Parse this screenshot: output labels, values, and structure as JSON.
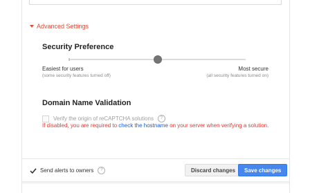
{
  "advanced": {
    "label": "Advanced Settings"
  },
  "security": {
    "title": "Security Preference",
    "left_label": "Easiest for users",
    "left_sub": "(some security features turned off)",
    "right_label": "Most secure",
    "right_sub": "(all security features turned on)",
    "slider_level": 0.5
  },
  "domain": {
    "title": "Domain Name Validation",
    "verify_label": "Verify the origin of reCAPTCHA solutions",
    "verify_checked": false,
    "warning_pre": "If disabled, you are required to ",
    "warning_link": "check the hostname",
    "warning_post": " on your server when verifying a solution."
  },
  "footer": {
    "alerts_label": "Send alerts to owners",
    "alerts_checked": true,
    "discard_label": "Discard changes",
    "save_label": "Save changes"
  },
  "icons": {
    "help": "?"
  },
  "colors": {
    "accent_red": "#dd4b39",
    "link_blue": "#1a5dc9",
    "save_blue": "#4787ed",
    "warning_red": "#e53935"
  }
}
